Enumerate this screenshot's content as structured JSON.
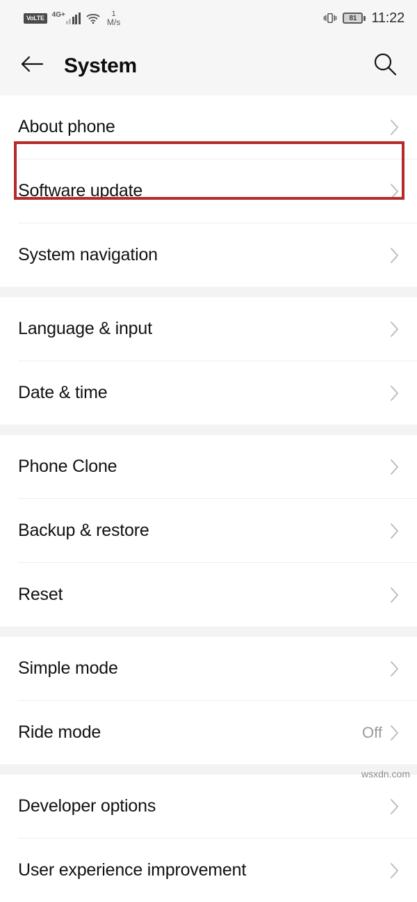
{
  "status_bar": {
    "volte_label": "VoLTE",
    "network_label": "4G+",
    "signal_icon": "signal-bars-icon",
    "wifi_icon": "wifi-icon",
    "data_speed_value": "1",
    "data_speed_unit": "M/s",
    "vibrate_icon": "vibrate-icon",
    "battery_level": "81",
    "time": "11:22"
  },
  "header": {
    "back_icon": "back-arrow-icon",
    "title": "System",
    "search_icon": "search-icon"
  },
  "colors": {
    "highlight_border": "#b52a2a",
    "background": "#ffffff",
    "header_background": "#f6f6f6",
    "section_gap": "#f3f3f3",
    "text_primary": "#111111",
    "text_secondary": "#9a9a9a"
  },
  "sections": [
    {
      "rows": [
        {
          "label": "About phone",
          "value": "",
          "highlighted": false
        },
        {
          "label": "Software update",
          "value": "",
          "highlighted": true
        },
        {
          "label": "System navigation",
          "value": "",
          "highlighted": false
        }
      ]
    },
    {
      "rows": [
        {
          "label": "Language & input",
          "value": "",
          "highlighted": false
        },
        {
          "label": "Date & time",
          "value": "",
          "highlighted": false
        }
      ]
    },
    {
      "rows": [
        {
          "label": "Phone Clone",
          "value": "",
          "highlighted": false
        },
        {
          "label": "Backup & restore",
          "value": "",
          "highlighted": false
        },
        {
          "label": "Reset",
          "value": "",
          "highlighted": false
        }
      ]
    },
    {
      "rows": [
        {
          "label": "Simple mode",
          "value": "",
          "highlighted": false
        },
        {
          "label": "Ride mode",
          "value": "Off",
          "highlighted": false
        }
      ]
    },
    {
      "rows": [
        {
          "label": "Developer options",
          "value": "",
          "highlighted": false
        },
        {
          "label": "User experience improvement",
          "value": "",
          "highlighted": false
        }
      ]
    }
  ],
  "watermark": "wsxdn.com"
}
